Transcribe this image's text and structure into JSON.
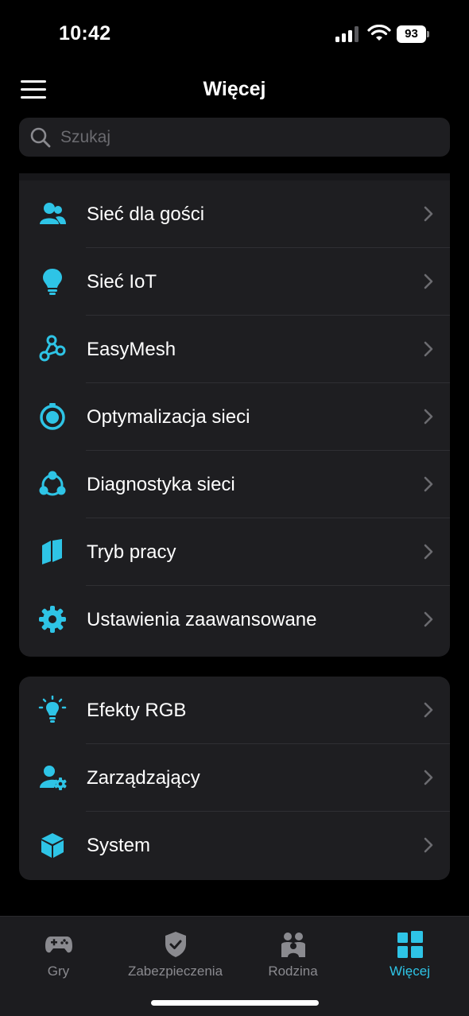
{
  "status_bar": {
    "time": "10:42",
    "battery": "93",
    "signal_icon": "cellular-signal-icon",
    "wifi_icon": "wifi-icon"
  },
  "header": {
    "title": "Więcej",
    "menu_icon": "hamburger-menu-icon"
  },
  "search": {
    "placeholder": "Szukaj",
    "value": ""
  },
  "groups": [
    {
      "items": [
        {
          "label": "Sieć dla gości",
          "icon": "guest-users-icon"
        },
        {
          "label": "Sieć IoT",
          "icon": "lightbulb-icon"
        },
        {
          "label": "EasyMesh",
          "icon": "mesh-nodes-icon"
        },
        {
          "label": "Optymalizacja sieci",
          "icon": "stopwatch-icon"
        },
        {
          "label": "Diagnostyka sieci",
          "icon": "diagnostics-nodes-icon"
        },
        {
          "label": "Tryb pracy",
          "icon": "map-mode-icon"
        },
        {
          "label": "Ustawienia zaawansowane",
          "icon": "gear-icon"
        }
      ]
    },
    {
      "items": [
        {
          "label": "Efekty RGB",
          "icon": "rgb-bulb-icon"
        },
        {
          "label": "Zarządzający",
          "icon": "user-settings-icon"
        },
        {
          "label": "System",
          "icon": "cube-icon"
        }
      ]
    }
  ],
  "tabs": [
    {
      "label": "Gry",
      "icon": "gamepad-icon",
      "active": false
    },
    {
      "label": "Zabezpieczenia",
      "icon": "shield-check-icon",
      "active": false
    },
    {
      "label": "Rodzina",
      "icon": "family-icon",
      "active": false
    },
    {
      "label": "Więcej",
      "icon": "grid-tiles-icon",
      "active": true
    }
  ],
  "colors": {
    "accent": "#2ec4e6",
    "background": "#000000",
    "card": "#1e1e21",
    "inactive_tab": "#8a8a8f"
  }
}
